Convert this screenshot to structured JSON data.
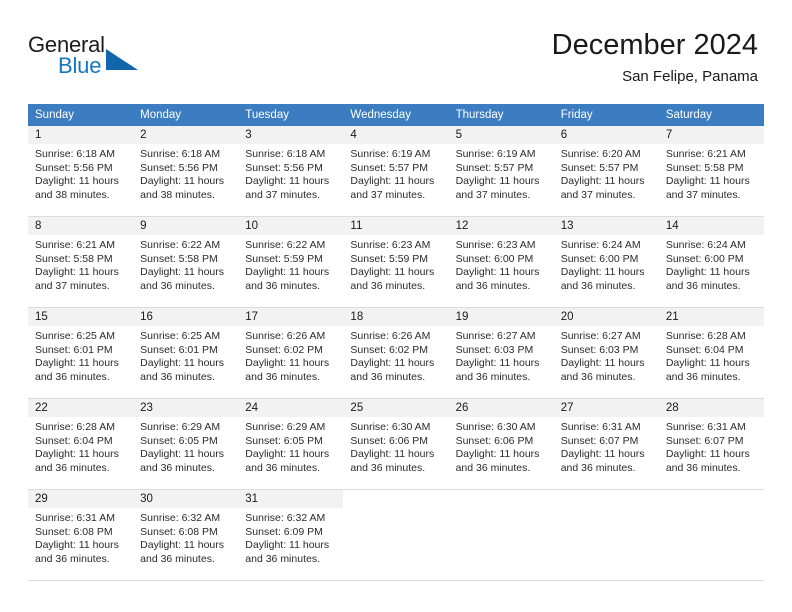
{
  "brand": {
    "line1": "General",
    "line2": "Blue",
    "accent_color": "#1477bf",
    "triangle_color": "#1166ab"
  },
  "header": {
    "title": "December 2024",
    "subtitle": "San Felipe, Panama"
  },
  "theme": {
    "header_row_bg": "#3b7dc0",
    "daynum_bg": "#f2f2f2",
    "grid_line": "#dcdcdc",
    "text": "#2b2b2b"
  },
  "weekdays": [
    "Sunday",
    "Monday",
    "Tuesday",
    "Wednesday",
    "Thursday",
    "Friday",
    "Saturday"
  ],
  "weeks": [
    [
      {
        "day": "1",
        "sunrise": "Sunrise: 6:18 AM",
        "sunset": "Sunset: 5:56 PM",
        "daylight1": "Daylight: 11 hours",
        "daylight2": "and 38 minutes."
      },
      {
        "day": "2",
        "sunrise": "Sunrise: 6:18 AM",
        "sunset": "Sunset: 5:56 PM",
        "daylight1": "Daylight: 11 hours",
        "daylight2": "and 38 minutes."
      },
      {
        "day": "3",
        "sunrise": "Sunrise: 6:18 AM",
        "sunset": "Sunset: 5:56 PM",
        "daylight1": "Daylight: 11 hours",
        "daylight2": "and 37 minutes."
      },
      {
        "day": "4",
        "sunrise": "Sunrise: 6:19 AM",
        "sunset": "Sunset: 5:57 PM",
        "daylight1": "Daylight: 11 hours",
        "daylight2": "and 37 minutes."
      },
      {
        "day": "5",
        "sunrise": "Sunrise: 6:19 AM",
        "sunset": "Sunset: 5:57 PM",
        "daylight1": "Daylight: 11 hours",
        "daylight2": "and 37 minutes."
      },
      {
        "day": "6",
        "sunrise": "Sunrise: 6:20 AM",
        "sunset": "Sunset: 5:57 PM",
        "daylight1": "Daylight: 11 hours",
        "daylight2": "and 37 minutes."
      },
      {
        "day": "7",
        "sunrise": "Sunrise: 6:21 AM",
        "sunset": "Sunset: 5:58 PM",
        "daylight1": "Daylight: 11 hours",
        "daylight2": "and 37 minutes."
      }
    ],
    [
      {
        "day": "8",
        "sunrise": "Sunrise: 6:21 AM",
        "sunset": "Sunset: 5:58 PM",
        "daylight1": "Daylight: 11 hours",
        "daylight2": "and 37 minutes."
      },
      {
        "day": "9",
        "sunrise": "Sunrise: 6:22 AM",
        "sunset": "Sunset: 5:58 PM",
        "daylight1": "Daylight: 11 hours",
        "daylight2": "and 36 minutes."
      },
      {
        "day": "10",
        "sunrise": "Sunrise: 6:22 AM",
        "sunset": "Sunset: 5:59 PM",
        "daylight1": "Daylight: 11 hours",
        "daylight2": "and 36 minutes."
      },
      {
        "day": "11",
        "sunrise": "Sunrise: 6:23 AM",
        "sunset": "Sunset: 5:59 PM",
        "daylight1": "Daylight: 11 hours",
        "daylight2": "and 36 minutes."
      },
      {
        "day": "12",
        "sunrise": "Sunrise: 6:23 AM",
        "sunset": "Sunset: 6:00 PM",
        "daylight1": "Daylight: 11 hours",
        "daylight2": "and 36 minutes."
      },
      {
        "day": "13",
        "sunrise": "Sunrise: 6:24 AM",
        "sunset": "Sunset: 6:00 PM",
        "daylight1": "Daylight: 11 hours",
        "daylight2": "and 36 minutes."
      },
      {
        "day": "14",
        "sunrise": "Sunrise: 6:24 AM",
        "sunset": "Sunset: 6:00 PM",
        "daylight1": "Daylight: 11 hours",
        "daylight2": "and 36 minutes."
      }
    ],
    [
      {
        "day": "15",
        "sunrise": "Sunrise: 6:25 AM",
        "sunset": "Sunset: 6:01 PM",
        "daylight1": "Daylight: 11 hours",
        "daylight2": "and 36 minutes."
      },
      {
        "day": "16",
        "sunrise": "Sunrise: 6:25 AM",
        "sunset": "Sunset: 6:01 PM",
        "daylight1": "Daylight: 11 hours",
        "daylight2": "and 36 minutes."
      },
      {
        "day": "17",
        "sunrise": "Sunrise: 6:26 AM",
        "sunset": "Sunset: 6:02 PM",
        "daylight1": "Daylight: 11 hours",
        "daylight2": "and 36 minutes."
      },
      {
        "day": "18",
        "sunrise": "Sunrise: 6:26 AM",
        "sunset": "Sunset: 6:02 PM",
        "daylight1": "Daylight: 11 hours",
        "daylight2": "and 36 minutes."
      },
      {
        "day": "19",
        "sunrise": "Sunrise: 6:27 AM",
        "sunset": "Sunset: 6:03 PM",
        "daylight1": "Daylight: 11 hours",
        "daylight2": "and 36 minutes."
      },
      {
        "day": "20",
        "sunrise": "Sunrise: 6:27 AM",
        "sunset": "Sunset: 6:03 PM",
        "daylight1": "Daylight: 11 hours",
        "daylight2": "and 36 minutes."
      },
      {
        "day": "21",
        "sunrise": "Sunrise: 6:28 AM",
        "sunset": "Sunset: 6:04 PM",
        "daylight1": "Daylight: 11 hours",
        "daylight2": "and 36 minutes."
      }
    ],
    [
      {
        "day": "22",
        "sunrise": "Sunrise: 6:28 AM",
        "sunset": "Sunset: 6:04 PM",
        "daylight1": "Daylight: 11 hours",
        "daylight2": "and 36 minutes."
      },
      {
        "day": "23",
        "sunrise": "Sunrise: 6:29 AM",
        "sunset": "Sunset: 6:05 PM",
        "daylight1": "Daylight: 11 hours",
        "daylight2": "and 36 minutes."
      },
      {
        "day": "24",
        "sunrise": "Sunrise: 6:29 AM",
        "sunset": "Sunset: 6:05 PM",
        "daylight1": "Daylight: 11 hours",
        "daylight2": "and 36 minutes."
      },
      {
        "day": "25",
        "sunrise": "Sunrise: 6:30 AM",
        "sunset": "Sunset: 6:06 PM",
        "daylight1": "Daylight: 11 hours",
        "daylight2": "and 36 minutes."
      },
      {
        "day": "26",
        "sunrise": "Sunrise: 6:30 AM",
        "sunset": "Sunset: 6:06 PM",
        "daylight1": "Daylight: 11 hours",
        "daylight2": "and 36 minutes."
      },
      {
        "day": "27",
        "sunrise": "Sunrise: 6:31 AM",
        "sunset": "Sunset: 6:07 PM",
        "daylight1": "Daylight: 11 hours",
        "daylight2": "and 36 minutes."
      },
      {
        "day": "28",
        "sunrise": "Sunrise: 6:31 AM",
        "sunset": "Sunset: 6:07 PM",
        "daylight1": "Daylight: 11 hours",
        "daylight2": "and 36 minutes."
      }
    ],
    [
      {
        "day": "29",
        "sunrise": "Sunrise: 6:31 AM",
        "sunset": "Sunset: 6:08 PM",
        "daylight1": "Daylight: 11 hours",
        "daylight2": "and 36 minutes."
      },
      {
        "day": "30",
        "sunrise": "Sunrise: 6:32 AM",
        "sunset": "Sunset: 6:08 PM",
        "daylight1": "Daylight: 11 hours",
        "daylight2": "and 36 minutes."
      },
      {
        "day": "31",
        "sunrise": "Sunrise: 6:32 AM",
        "sunset": "Sunset: 6:09 PM",
        "daylight1": "Daylight: 11 hours",
        "daylight2": "and 36 minutes."
      },
      {
        "day": "",
        "sunrise": "",
        "sunset": "",
        "daylight1": "",
        "daylight2": ""
      },
      {
        "day": "",
        "sunrise": "",
        "sunset": "",
        "daylight1": "",
        "daylight2": ""
      },
      {
        "day": "",
        "sunrise": "",
        "sunset": "",
        "daylight1": "",
        "daylight2": ""
      },
      {
        "day": "",
        "sunrise": "",
        "sunset": "",
        "daylight1": "",
        "daylight2": ""
      }
    ]
  ]
}
